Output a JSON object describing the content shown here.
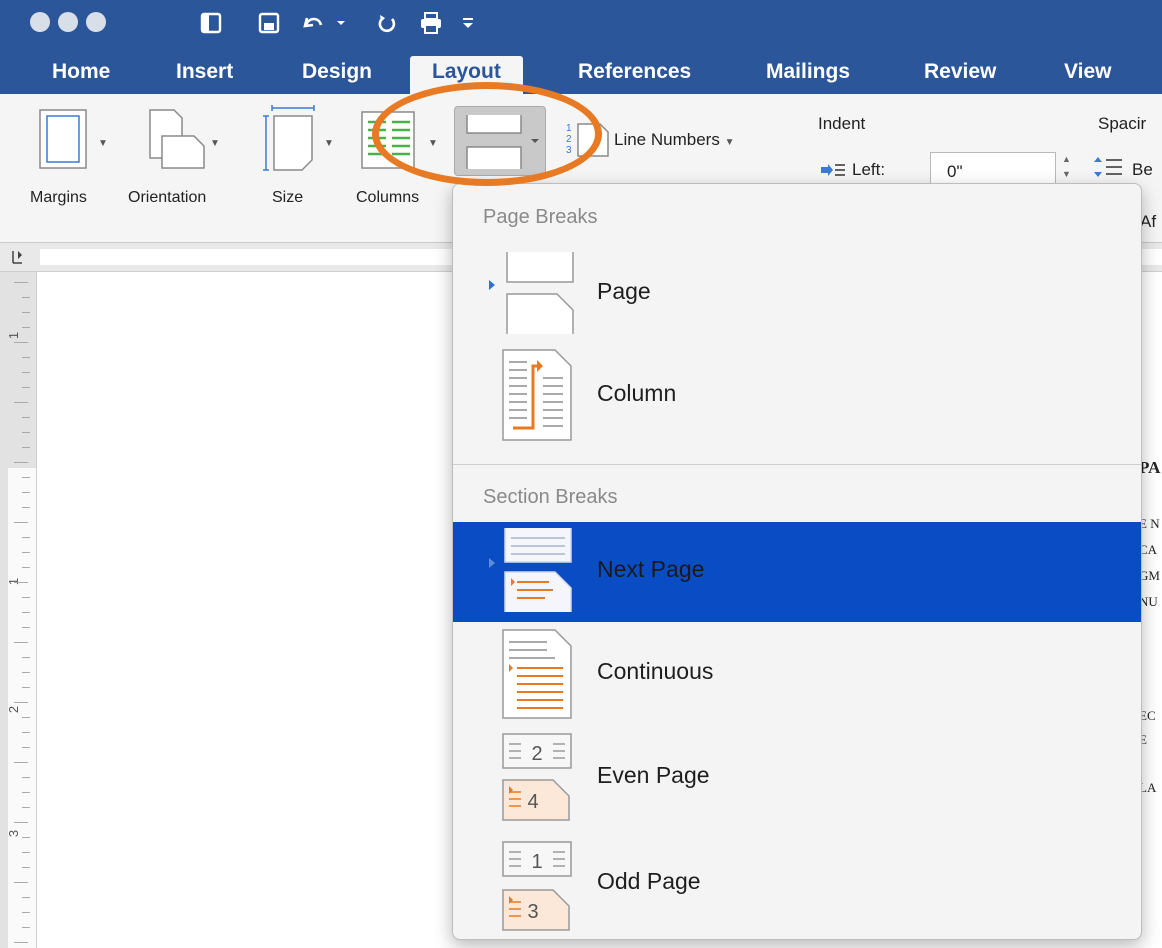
{
  "tabs": [
    {
      "label": "Home",
      "active": false
    },
    {
      "label": "Insert",
      "active": false
    },
    {
      "label": "Design",
      "active": false
    },
    {
      "label": "Layout",
      "active": true
    },
    {
      "label": "References",
      "active": false
    },
    {
      "label": "Mailings",
      "active": false
    },
    {
      "label": "Review",
      "active": false
    },
    {
      "label": "View",
      "active": false
    }
  ],
  "ribbon": {
    "margins": "Margins",
    "orientation": "Orientation",
    "size": "Size",
    "columns": "Columns",
    "line_numbers": "Line Numbers",
    "indent": "Indent",
    "spacing": "Spacir",
    "left_label": "Left:",
    "left_value": "0\"",
    "before_label": "Be",
    "after_label": "Af"
  },
  "vruler": {
    "marks": [
      "1",
      "1",
      "2",
      "3"
    ]
  },
  "doc_fragments": [
    "PA",
    "E N",
    "CA",
    "GM",
    "NU",
    "EC",
    "E",
    "LA"
  ],
  "menu": {
    "page_breaks_header": "Page Breaks",
    "section_breaks_header": "Section Breaks",
    "items": [
      {
        "label": "Page"
      },
      {
        "label": "Column"
      },
      {
        "label": "Next Page",
        "selected": true
      },
      {
        "label": "Continuous"
      },
      {
        "label": "Even Page",
        "num_top": "2",
        "num_bottom": "4"
      },
      {
        "label": "Odd Page",
        "num_top": "1",
        "num_bottom": "3"
      }
    ]
  },
  "colors": {
    "brand": "#2b579a",
    "highlight": "#0a4cc4",
    "callout": "#e87a23"
  }
}
